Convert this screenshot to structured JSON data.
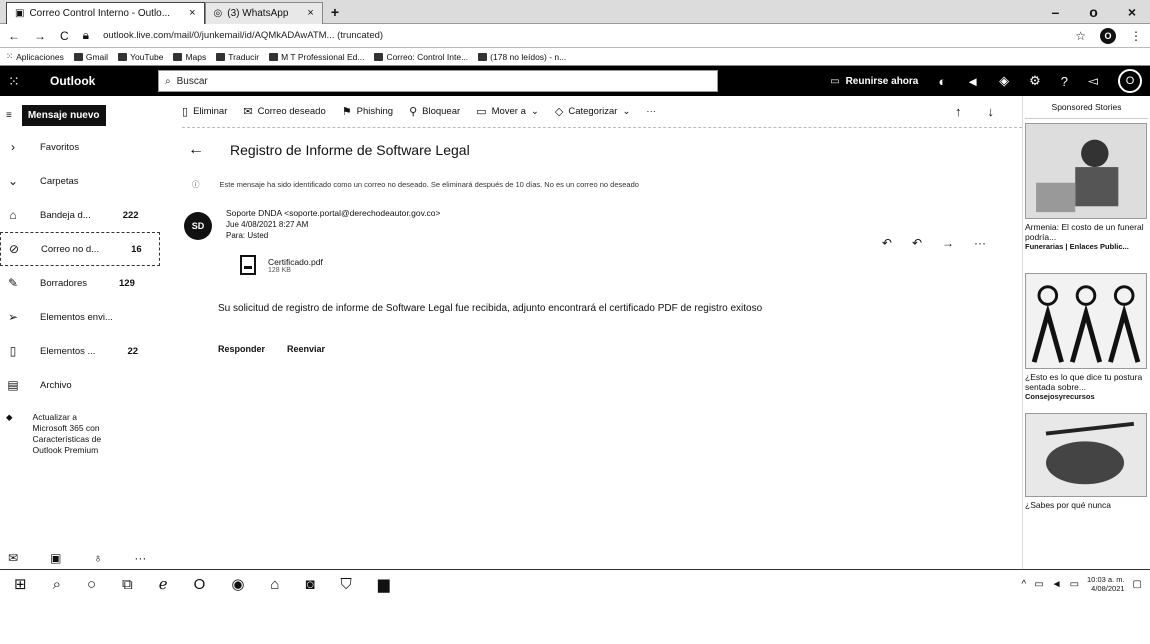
{
  "browser": {
    "tabs": [
      {
        "title": "Correo Control Interno - Outlo...",
        "active": true
      },
      {
        "title": "(3) WhatsApp",
        "active": false
      }
    ],
    "url": "outlook.live.com/mail/0/junkemail/id/AQMkADAwATM... (truncated)",
    "bookmarks": [
      "Aplicaciones",
      "Gmail",
      "YouTube",
      "Maps",
      "Traducir",
      "M T Professional Ed...",
      "Correo: Control Inte...",
      "(178 no leídos) - n..."
    ]
  },
  "outlook": {
    "brand": "Outlook",
    "search_placeholder": "Buscar",
    "meet_now": "Reunirse ahora",
    "avatar_initial": "O"
  },
  "sidebar": {
    "new_message": "Mensaje nuevo",
    "items": [
      {
        "label": "Favoritos",
        "count": "",
        "icon": "chevron-right-icon"
      },
      {
        "label": "Carpetas",
        "count": "",
        "icon": "chevron-down-icon"
      },
      {
        "label": "Bandeja d...",
        "count": "222",
        "icon": "inbox-icon"
      },
      {
        "label": "Correo no d...",
        "count": "16",
        "icon": "junk-icon"
      },
      {
        "label": "Borradores",
        "count": "129",
        "icon": "pencil-icon"
      },
      {
        "label": "Elementos envi...",
        "count": "",
        "icon": "sent-icon"
      },
      {
        "label": "Elementos ...",
        "count": "22",
        "icon": "trash-icon"
      },
      {
        "label": "Archivo",
        "count": "",
        "icon": "archive-icon"
      }
    ],
    "promo": "Actualizar a Microsoft 365 con Características de Outlook Premium"
  },
  "commands": [
    "Eliminar",
    "Correo deseado",
    "Phishing",
    "Bloquear",
    "Mover a",
    "Categorizar",
    "···"
  ],
  "message": {
    "subject": "Registro de Informe de Software Legal",
    "junk_notice": "Este mensaje ha sido identificado como un correo no deseado. Se eliminará después de 10 días. No es un correo no deseado",
    "avatar": "SD",
    "from": "Soporte DNDA <soporte.portal@derechodeautor.gov.co>",
    "date": "Jue 4/08/2021 8:27 AM",
    "to": "Para: Usted",
    "attachment": {
      "name": "Certificado.pdf",
      "size": "128 KB"
    },
    "body": "Su solicitud de registro de informe de Software Legal fue recibida, adjunto encontrará el certificado PDF de registro exitoso",
    "reply": "Responder",
    "forward": "Reenviar"
  },
  "ads": {
    "title": "Sponsored Stories",
    "items": [
      {
        "text": "Armenia: El costo de un funeral podría...",
        "source": "Funerarias | Enlaces Public..."
      },
      {
        "text": "¿Esto es lo que dice tu postura sentada sobre...",
        "source": "Consejosyrecursos"
      },
      {
        "text": "¿Sabes por qué nunca",
        "source": ""
      }
    ]
  },
  "taskbar": {
    "time": "10:03 a. m.",
    "date": "4/08/2021"
  }
}
